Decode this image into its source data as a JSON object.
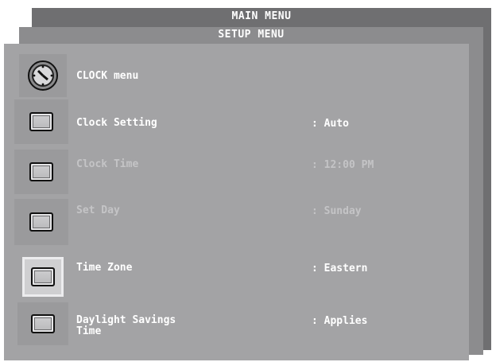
{
  "menu": {
    "main_title": "MAIN MENU",
    "setup_title": "SETUP MENU",
    "clock_title": "CLOCK menu",
    "items": [
      {
        "label": "Clock Setting",
        "value": ": Auto",
        "enabled": true
      },
      {
        "label": "Clock Time",
        "value": ": 12:00 PM",
        "enabled": false
      },
      {
        "label": "Set Day",
        "value": ": Sunday",
        "enabled": false
      },
      {
        "label": "Time Zone",
        "value": ": Eastern",
        "enabled": true,
        "selected": true
      },
      {
        "label": "Daylight Savings\nTime",
        "value": ": Applies",
        "enabled": true
      }
    ]
  },
  "icons": {
    "header": "clock-icon",
    "item": "menu-item-icon"
  },
  "colors": {
    "main_panel": "#6f6f71",
    "setup_panel": "#8c8c8e",
    "clock_panel": "#a3a3a5",
    "text": "#ffffff",
    "disabled_text": "#c4c4c6"
  }
}
